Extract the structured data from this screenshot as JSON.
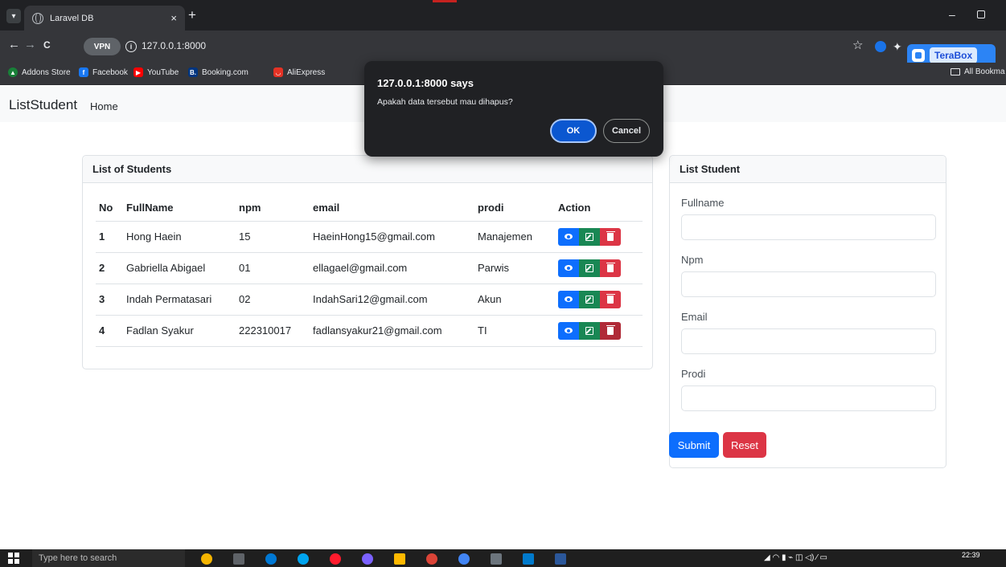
{
  "browser": {
    "tab_title": "Laravel DB",
    "tab_close": "×",
    "new_tab": "+",
    "url": "127.0.0.1:8000",
    "vpn_label": "VPN",
    "back": "←",
    "forward": "→",
    "reload": "C",
    "star": "☆",
    "window_min": "–",
    "bookmarks": [
      {
        "label": "Addons Store",
        "color": "#188038",
        "glyph": "▲"
      },
      {
        "label": "Facebook",
        "color": "#1877f2",
        "glyph": "f"
      },
      {
        "label": "YouTube",
        "color": "#ff0000",
        "glyph": "▶"
      },
      {
        "label": "Booking.com",
        "color": "#003580",
        "glyph": "B."
      },
      {
        "label": "AliExpress",
        "color": "#e43225",
        "glyph": "◡"
      }
    ],
    "all_bookmarks": "All Bookma",
    "extension_label": "TeraBox"
  },
  "app": {
    "brand": "ListStudent",
    "nav_home": "Home"
  },
  "list_card": {
    "header": "List of Students",
    "columns": [
      "No",
      "FullName",
      "npm",
      "email",
      "prodi",
      "Action"
    ],
    "rows": [
      {
        "no": "1",
        "name": "Hong Haein",
        "npm": "15",
        "email": "HaeinHong15@gmail.com",
        "prodi": "Manajemen"
      },
      {
        "no": "2",
        "name": "Gabriella Abigael",
        "npm": "01",
        "email": "ellagael@gmail.com",
        "prodi": "Parwis"
      },
      {
        "no": "3",
        "name": "Indah Permatasari",
        "npm": "02",
        "email": "IndahSari12@gmail.com",
        "prodi": "Akun"
      },
      {
        "no": "4",
        "name": "Fadlan Syakur",
        "npm": "222310017",
        "email": "fadlansyakur21@gmail.com",
        "prodi": "TI"
      }
    ]
  },
  "form_card": {
    "header": "List Student",
    "fields": [
      {
        "label": "Fullname",
        "value": ""
      },
      {
        "label": "Npm",
        "value": ""
      },
      {
        "label": "Email",
        "value": ""
      },
      {
        "label": "Prodi",
        "value": ""
      }
    ],
    "submit_label": "Submit",
    "reset_label": "Reset"
  },
  "dialog": {
    "title": "127.0.0.1:8000 says",
    "message": "Apakah data tersebut mau dihapus?",
    "ok_label": "OK",
    "cancel_label": "Cancel"
  },
  "taskbar": {
    "search_placeholder": "Type here to search",
    "clock": "22:39"
  }
}
